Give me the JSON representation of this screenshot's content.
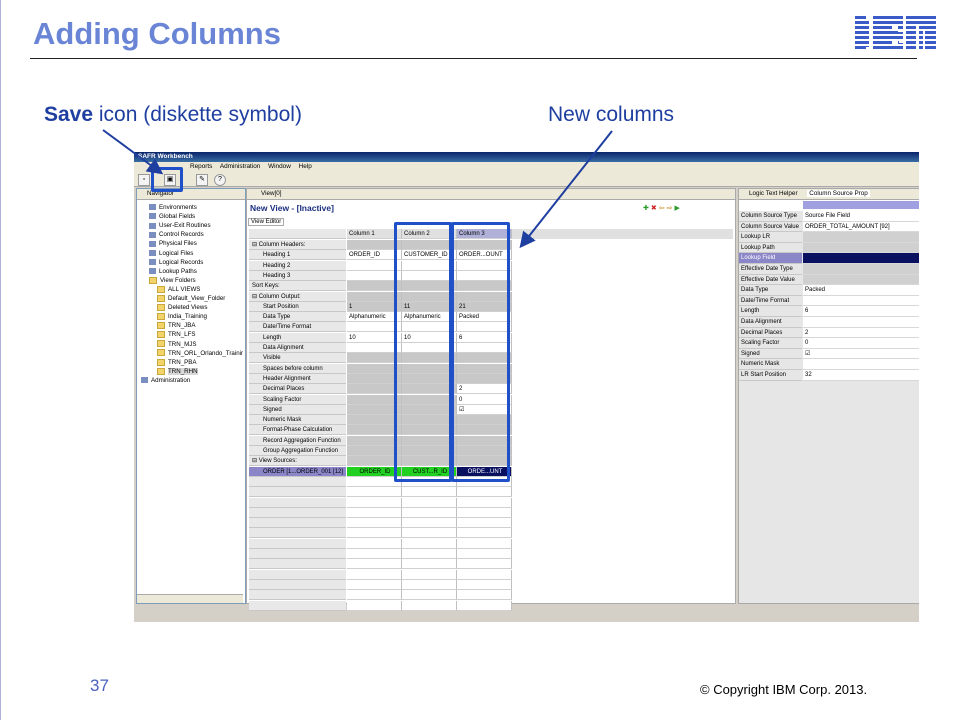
{
  "slide": {
    "title": "Adding Columns",
    "callout_save_bold": "Save",
    "callout_save_rest": " icon (diskette symbol)",
    "callout_new_columns": "New columns",
    "page_number": "37",
    "copyright": "© Copyright  IBM Corp. 2013.",
    "accent_color": "#6b85d6",
    "callout_color": "#1f3fa0"
  },
  "app": {
    "window_title": "SAFR Workbench",
    "menu": [
      "Reports",
      "Administration",
      "Window",
      "Help"
    ],
    "navigator_tab": "Navigator",
    "view_tab": "View[0]",
    "logic_tab": "Logic Text Helper",
    "props_tab": "Column Source Prop",
    "tree": [
      {
        "label": "Environments",
        "indent": 1,
        "icon": "env-icon"
      },
      {
        "label": "Global Fields",
        "indent": 1,
        "icon": "globe-icon"
      },
      {
        "label": "User-Exit Routines",
        "indent": 1,
        "icon": "routine-icon"
      },
      {
        "label": "Control Records",
        "indent": 1,
        "icon": "record-icon"
      },
      {
        "label": "Physical Files",
        "indent": 1,
        "icon": "file-icon"
      },
      {
        "label": "Logical Files",
        "indent": 1,
        "icon": "file-icon"
      },
      {
        "label": "Logical Records",
        "indent": 1,
        "icon": "record-icon"
      },
      {
        "label": "Lookup Paths",
        "indent": 1,
        "icon": "lookup-icon"
      },
      {
        "label": "View Folders",
        "indent": 1,
        "icon": "folder-icon"
      },
      {
        "label": "ALL VIEWS",
        "indent": 2,
        "icon": "folder-icon"
      },
      {
        "label": "Default_View_Folder",
        "indent": 2,
        "icon": "folder-icon"
      },
      {
        "label": "Deleted Views",
        "indent": 2,
        "icon": "folder-icon"
      },
      {
        "label": "India_Training",
        "indent": 2,
        "icon": "folder-icon"
      },
      {
        "label": "TRN_JBA",
        "indent": 2,
        "icon": "folder-icon"
      },
      {
        "label": "TRN_LFS",
        "indent": 2,
        "icon": "folder-icon"
      },
      {
        "label": "TRN_MJS",
        "indent": 2,
        "icon": "folder-icon"
      },
      {
        "label": "TRN_ORL_Orlando_Trainir",
        "indent": 2,
        "icon": "folder-icon"
      },
      {
        "label": "TRN_PBA",
        "indent": 2,
        "icon": "folder-icon"
      },
      {
        "label": "TRN_RHN",
        "indent": 2,
        "icon": "folder-icon"
      },
      {
        "label": "Administration",
        "indent": 0,
        "icon": "admin-icon"
      }
    ],
    "editor": {
      "title": "New View - [Inactive]",
      "subtab": "View Editor",
      "columns": [
        "Column 1",
        "Column 2",
        "Column 3"
      ],
      "rows": [
        {
          "label": "⊟  Column Headers:",
          "vals": [
            "",
            "",
            ""
          ],
          "style": "gray"
        },
        {
          "label": "Heading 1",
          "vals": [
            "ORDER_ID",
            "CUSTOMER_ID",
            "ORDER...OUNT"
          ],
          "style": "white"
        },
        {
          "label": "Heading 2",
          "vals": [
            "",
            "",
            ""
          ],
          "style": "white"
        },
        {
          "label": "Heading 3",
          "vals": [
            "",
            "",
            ""
          ],
          "style": "white"
        },
        {
          "label": "Sort Keys:",
          "vals": [
            "",
            "",
            ""
          ],
          "style": "gray"
        },
        {
          "label": "⊟  Column Output:",
          "vals": [
            "",
            "",
            ""
          ],
          "style": "gray"
        },
        {
          "label": "Start Position",
          "vals": [
            "1",
            "11",
            "21"
          ],
          "style": "gray"
        },
        {
          "label": "Data Type",
          "vals": [
            "Alphanumeric",
            "Alphanumeric",
            "Packed"
          ],
          "style": "white"
        },
        {
          "label": "Date/Time Format",
          "vals": [
            "",
            "",
            ""
          ],
          "style": "white"
        },
        {
          "label": "Length",
          "vals": [
            "10",
            "10",
            "6"
          ],
          "style": "white"
        },
        {
          "label": "Data Alignment",
          "vals": [
            "",
            "",
            ""
          ],
          "style": "white"
        },
        {
          "label": "Visible",
          "vals": [
            "",
            "",
            ""
          ],
          "style": "gray"
        },
        {
          "label": "Spaces before column",
          "vals": [
            "",
            "",
            ""
          ],
          "style": "gray"
        },
        {
          "label": "Header Alignment",
          "vals": [
            "",
            "",
            ""
          ],
          "style": "gray"
        },
        {
          "label": "Decimal Places",
          "vals": [
            "",
            "",
            "2"
          ],
          "style": "mixed"
        },
        {
          "label": "Scaling Factor",
          "vals": [
            "",
            "",
            "0"
          ],
          "style": "mixed"
        },
        {
          "label": "Signed",
          "vals": [
            "",
            "",
            "☑"
          ],
          "style": "mixed"
        },
        {
          "label": "Numeric Mask",
          "vals": [
            "",
            "",
            ""
          ],
          "style": "gray"
        },
        {
          "label": "Format-Phase Calculation",
          "vals": [
            "",
            "",
            ""
          ],
          "style": "gray"
        },
        {
          "label": "Record Aggregation Function",
          "vals": [
            "",
            "",
            ""
          ],
          "style": "gray"
        },
        {
          "label": "Group Aggregation Function",
          "vals": [
            "",
            "",
            ""
          ],
          "style": "gray"
        },
        {
          "label": "⊟  View Sources:",
          "vals": [
            "",
            "",
            ""
          ],
          "style": "gray"
        }
      ],
      "source_row": {
        "label": "ORDER [1...ORDER_001 [12]",
        "vals": [
          "ORDER_ID",
          "CUST...R_ID",
          "ORDE...UNT"
        ]
      }
    },
    "properties": [
      {
        "label": "Column Source Type",
        "value": "Source File Field"
      },
      {
        "label": "Column Source Value",
        "value": "ORDER_TOTAL_AMOUNT [92]"
      },
      {
        "label": "Lookup LR",
        "value": ""
      },
      {
        "label": "Lookup Path",
        "value": ""
      },
      {
        "label": "Lookup Field",
        "value": "",
        "selected": true
      },
      {
        "label": "Effective Date Type",
        "value": ""
      },
      {
        "label": "Effective Date Value",
        "value": ""
      },
      {
        "label": "Data Type",
        "value": "Packed"
      },
      {
        "label": "Date/Time Format",
        "value": ""
      },
      {
        "label": "Length",
        "value": "6"
      },
      {
        "label": "Data Alignment",
        "value": ""
      },
      {
        "label": "Decimal Places",
        "value": "2"
      },
      {
        "label": "Scaling Factor",
        "value": "0"
      },
      {
        "label": "Signed",
        "value": "☑"
      },
      {
        "label": "Numeric Mask",
        "value": ""
      },
      {
        "label": "LR Start Position",
        "value": "32"
      }
    ]
  }
}
